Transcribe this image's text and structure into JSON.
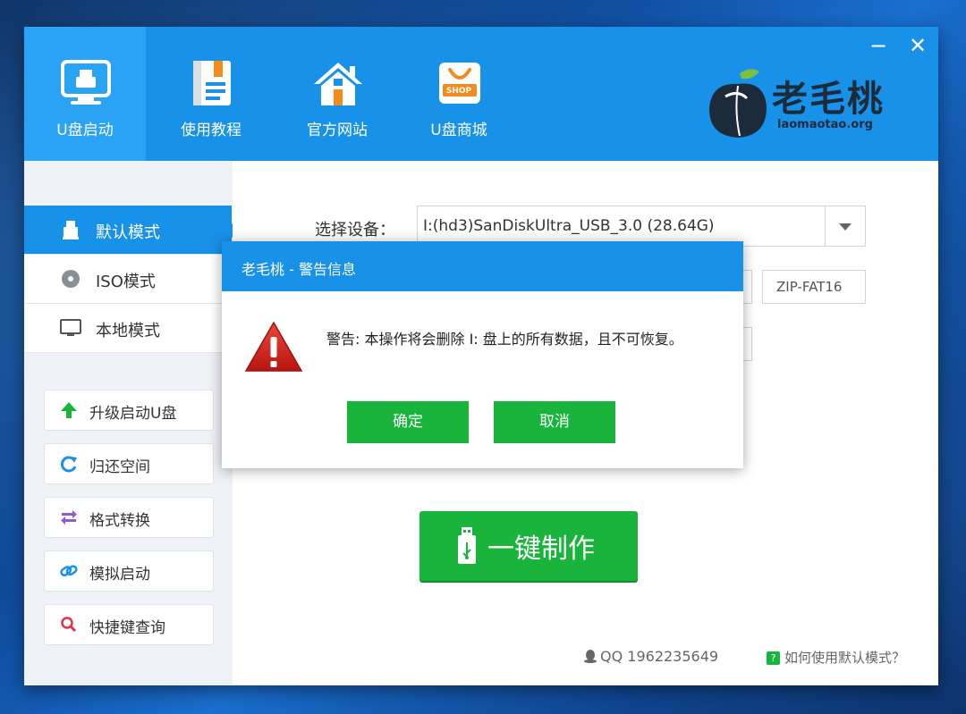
{
  "header": {
    "nav": [
      {
        "label": "U盘启动",
        "icon": "monitor-usb-icon"
      },
      {
        "label": "使用教程",
        "icon": "document-icon"
      },
      {
        "label": "官方网站",
        "icon": "home-icon"
      },
      {
        "label": "U盘商城",
        "icon": "shop-bag-icon"
      }
    ],
    "shop_badge": "SHOP",
    "minimize": "−",
    "close": "✕",
    "brand": {
      "name": "老毛桃",
      "url": "laomaotao.org"
    }
  },
  "sidebar": {
    "modes": [
      {
        "label": "默认模式",
        "icon": "usb-drive-icon"
      },
      {
        "label": "ISO模式",
        "icon": "disc-icon"
      },
      {
        "label": "本地模式",
        "icon": "monitor-icon"
      }
    ],
    "tools": [
      {
        "label": "升级启动U盘",
        "icon": "arrow-up-icon"
      },
      {
        "label": "归还空间",
        "icon": "refresh-icon"
      },
      {
        "label": "格式转换",
        "icon": "swap-icon"
      },
      {
        "label": "模拟启动",
        "icon": "link-icon"
      },
      {
        "label": "快捷键查询",
        "icon": "search-icon"
      }
    ]
  },
  "main": {
    "device_label": "选择设备：",
    "device_value": "I:(hd3)SanDiskUltra_USB_3.0 (28.64G)",
    "format_value": "ZIP-FAT16",
    "make_button": "一键制作",
    "qq": "QQ 1962235649",
    "help": "如何使用默认模式？",
    "help_badge": "?"
  },
  "dialog": {
    "title": "老毛桃 - 警告信息",
    "message": "警告: 本操作将会删除 I: 盘上的所有数据，且不可恢复。",
    "ok": "确定",
    "cancel": "取消"
  },
  "colors": {
    "header": "#1891e9",
    "green": "#19b43c",
    "warning_red": "#d9261c"
  }
}
